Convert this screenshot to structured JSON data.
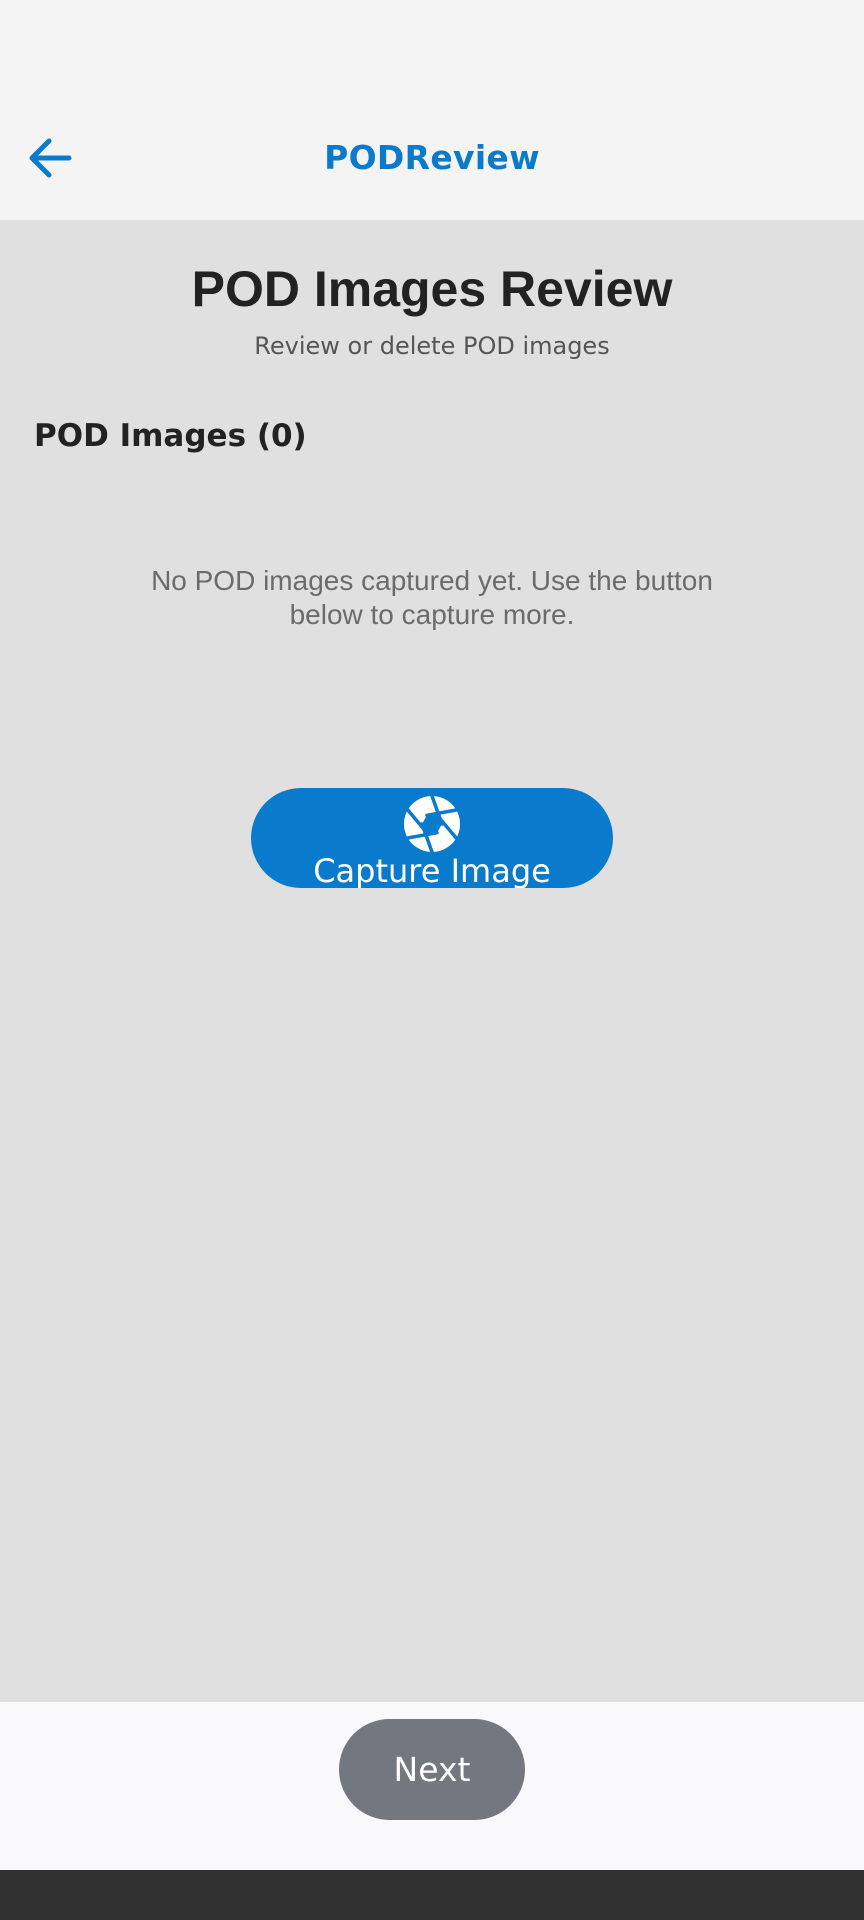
{
  "header": {
    "title": "PODReview",
    "back_icon": "arrow-left-icon",
    "accent_color": "#0a7bcc"
  },
  "main": {
    "title": "POD Images Review",
    "subtitle": "Review or delete POD images",
    "section_heading": "POD Images (0)",
    "empty_message": "No POD images captured yet. Use the button below to capture more.",
    "capture_button": {
      "label": "Capture Image",
      "icon": "camera-shutter-icon"
    }
  },
  "footer": {
    "next_label": "Next",
    "next_color": "#737780"
  }
}
